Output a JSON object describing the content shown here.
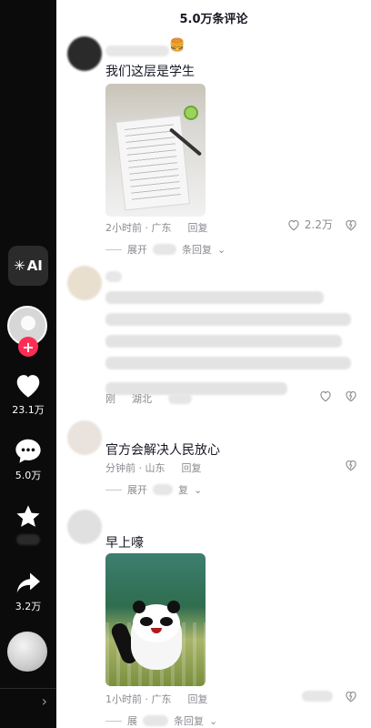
{
  "rail": {
    "ai_label": "AI",
    "likes": "23.1万",
    "comments": "5.0万",
    "shares": "3.2万"
  },
  "panel": {
    "title": "5.0万条评论"
  },
  "comments": [
    {
      "text": "我们这层是学生",
      "meta_time": "2小时前 · 广东",
      "reply": "回复",
      "likes": "2.2万",
      "expand_prefix": "展开",
      "expand_suffix": "条回复"
    },
    {
      "meta_time": "刚",
      "meta_location": "湖北"
    },
    {
      "text": "官方会解决人民放心",
      "meta_time": "分钟前 · 山东",
      "reply": "回复",
      "expand_prefix": "展开",
      "expand_suffix": "复"
    },
    {
      "text": "早上嚎",
      "meta_time": "1小时前 · 广东",
      "reply": "回复",
      "expand_prefix": "展",
      "expand_suffix": "条回复"
    }
  ],
  "colors": {
    "rail_bg": "#0b0b0b",
    "accent": "#fe2c55",
    "meta_text": "#8a8b91"
  },
  "icons": [
    "ai-icon",
    "heart-icon",
    "comment-icon",
    "star-icon",
    "share-icon",
    "disc-icon",
    "like-outline-icon",
    "dislike-icon",
    "chevron-down-icon"
  ]
}
